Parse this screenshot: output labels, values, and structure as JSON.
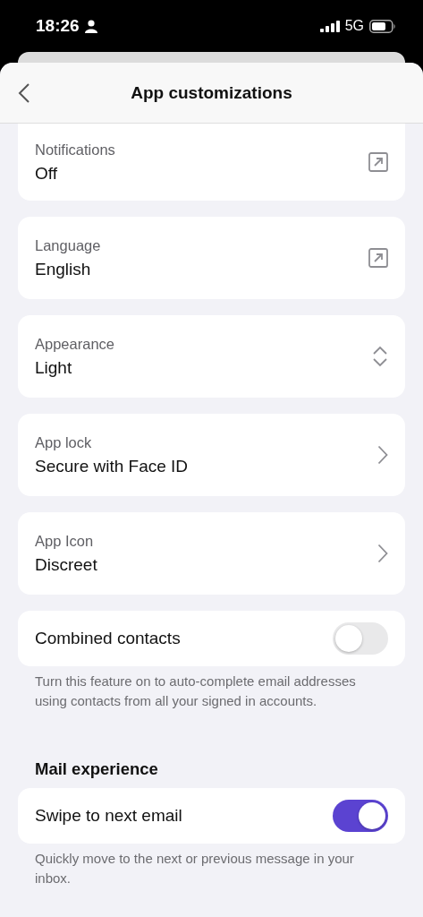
{
  "status_bar": {
    "time": "18:26",
    "network": "5G"
  },
  "header": {
    "title": "App customizations"
  },
  "sections": [
    {
      "items": [
        {
          "kind": "link",
          "label": "Notifications",
          "value": "Off"
        },
        {
          "kind": "link",
          "label": "Language",
          "value": "English"
        },
        {
          "kind": "select",
          "label": "Appearance",
          "value": "Light"
        },
        {
          "kind": "nav",
          "label": "App lock",
          "value": "Secure with Face ID"
        },
        {
          "kind": "nav",
          "label": "App Icon",
          "value": "Discreet"
        },
        {
          "kind": "toggle",
          "label": "Combined contacts",
          "on": false,
          "description": "Turn this feature on to auto-complete email addresses using contacts from all your signed in accounts."
        }
      ]
    },
    {
      "title": "Mail experience",
      "items": [
        {
          "kind": "toggle",
          "label": "Swipe to next email",
          "on": true,
          "description": "Quickly move to the next or previous message in your inbox."
        }
      ]
    }
  ]
}
